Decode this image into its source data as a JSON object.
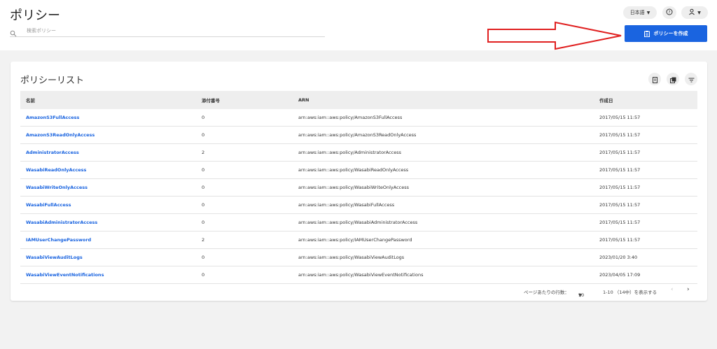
{
  "header": {
    "title": "ポリシー",
    "search_placeholder": "検索ポリシー",
    "language": "日本語",
    "create_button": "ポリシーを作成"
  },
  "card": {
    "title": "ポリシーリスト",
    "columns": [
      "名前",
      "添付番号",
      "ARN",
      "作成日"
    ],
    "rows": [
      {
        "name": "AmazonS3FullAccess",
        "count": "0",
        "arn": "arn:aws:iam::aws:policy/AmazonS3FullAccess",
        "created": "2017/05/15 11:57"
      },
      {
        "name": "AmazonS3ReadOnlyAccess",
        "count": "0",
        "arn": "arn:aws:iam::aws:policy/AmazonS3ReadOnlyAccess",
        "created": "2017/05/15 11:57"
      },
      {
        "name": "AdministratorAccess",
        "count": "2",
        "arn": "arn:aws:iam::aws:policy/AdministratorAccess",
        "created": "2017/05/15 11:57"
      },
      {
        "name": "WasabiReadOnlyAccess",
        "count": "0",
        "arn": "arn:aws:iam::aws:policy/WasabiReadOnlyAccess",
        "created": "2017/05/15 11:57"
      },
      {
        "name": "WasabiWriteOnlyAccess",
        "count": "0",
        "arn": "arn:aws:iam::aws:policy/WasabiWriteOnlyAccess",
        "created": "2017/05/15 11:57"
      },
      {
        "name": "WasabiFullAccess",
        "count": "0",
        "arn": "arn:aws:iam::aws:policy/WasabiFullAccess",
        "created": "2017/05/15 11:57"
      },
      {
        "name": "WasabiAdministratorAccess",
        "count": "0",
        "arn": "arn:aws:iam::aws:policy/WasabiAdministratorAccess",
        "created": "2017/05/15 11:57"
      },
      {
        "name": "IAMUserChangePassword",
        "count": "2",
        "arn": "arn:aws:iam::aws:policy/IAMUserChangePassword",
        "created": "2017/05/15 11:57"
      },
      {
        "name": "WasabiViewAuditLogs",
        "count": "0",
        "arn": "arn:aws:iam::aws:policy/WasabiViewAuditLogs",
        "created": "2023/01/20 3:40"
      },
      {
        "name": "WasabiViewEventNotifications",
        "count": "0",
        "arn": "arn:aws:iam::aws:policy/WasabiViewEventNotifications",
        "created": "2023/04/05 17:09"
      }
    ]
  },
  "pagination": {
    "rows_per_page_label": "ページあたりの行数：",
    "rows_per_page": "10",
    "range": "1-10 （14中）を表示する"
  },
  "colors": {
    "accent": "#1a64e0",
    "arrow": "#e02020"
  },
  "icons": [
    "search-icon",
    "help-icon",
    "user-icon",
    "clipboard-icon",
    "list-view-icon",
    "copy-icon",
    "filter-icon",
    "chevron-left-icon",
    "chevron-right-icon"
  ]
}
